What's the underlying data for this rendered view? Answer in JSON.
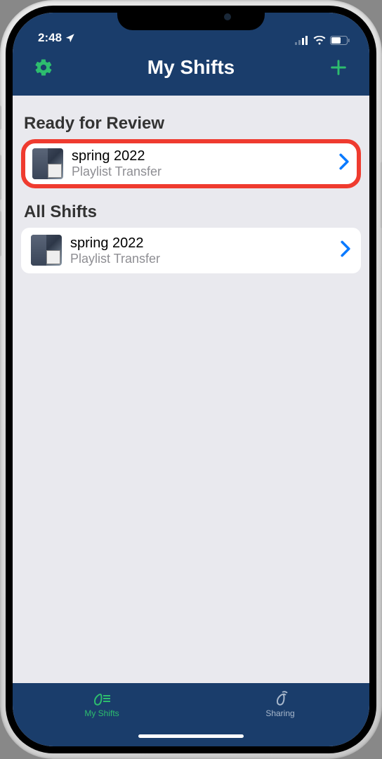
{
  "status_bar": {
    "time": "2:48"
  },
  "header": {
    "title": "My Shifts"
  },
  "sections": [
    {
      "title": "Ready for Review",
      "items": [
        {
          "title": "spring 2022",
          "subtitle": "Playlist Transfer",
          "highlighted": true
        }
      ]
    },
    {
      "title": "All Shifts",
      "items": [
        {
          "title": "spring 2022",
          "subtitle": "Playlist Transfer",
          "highlighted": false
        }
      ]
    }
  ],
  "tabs": [
    {
      "label": "My Shifts",
      "active": true
    },
    {
      "label": "Sharing",
      "active": false
    }
  ],
  "colors": {
    "header_bg": "#1a3d6b",
    "accent_green": "#2dbd6e",
    "highlight_red": "#ef3b2f",
    "chevron_blue": "#0a7aff"
  }
}
